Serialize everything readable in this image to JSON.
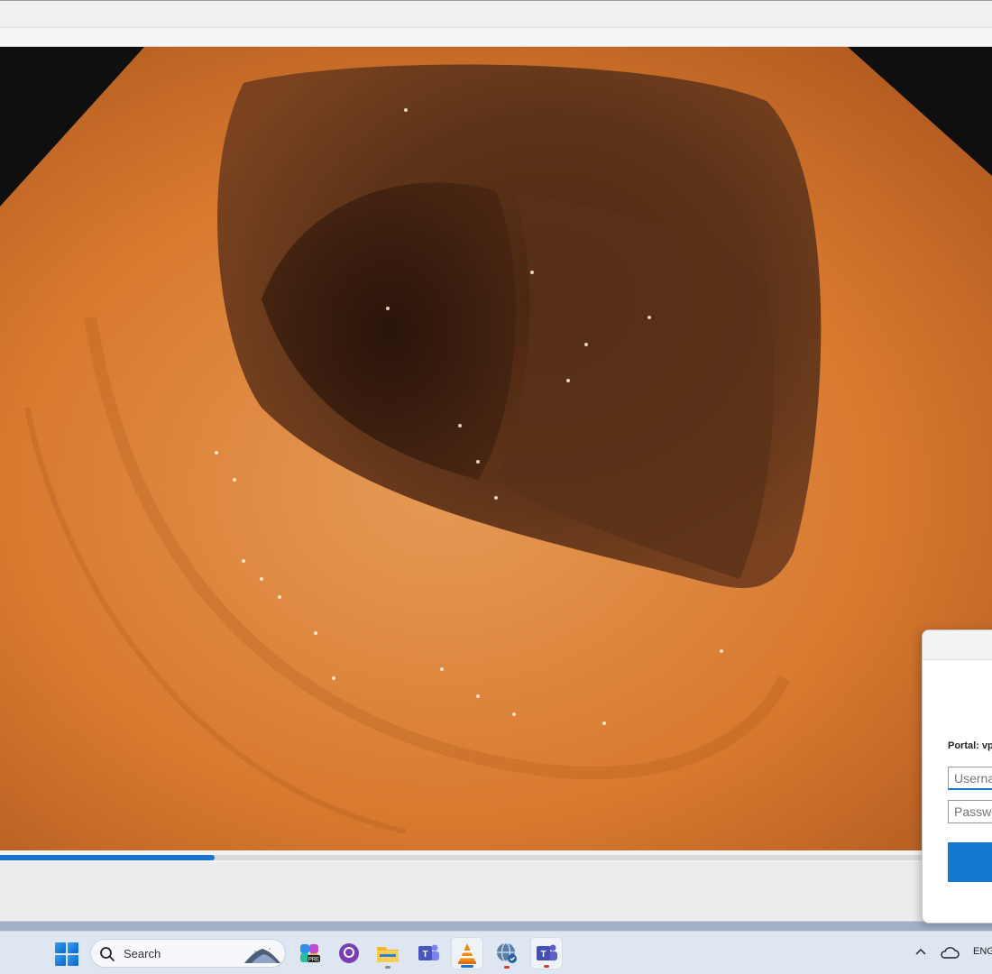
{
  "player": {
    "progress": 0.216
  },
  "dialog": {
    "portal_label": "Portal: vp",
    "username_placeholder": "Userna",
    "password_placeholder": "Passwo",
    "username_value": "",
    "password_value": ""
  },
  "taskbar": {
    "search_label": "Search",
    "language": "ENG",
    "apps": [
      {
        "name": "copilot-app-icon"
      },
      {
        "name": "github-desktop-icon"
      },
      {
        "name": "file-explorer-icon"
      },
      {
        "name": "teams-classic-icon"
      },
      {
        "name": "vlc-icon"
      },
      {
        "name": "vpn-globe-icon"
      },
      {
        "name": "teams-icon"
      }
    ]
  },
  "colors": {
    "accent": "#1a73d1",
    "tissue": "#d9762f"
  }
}
